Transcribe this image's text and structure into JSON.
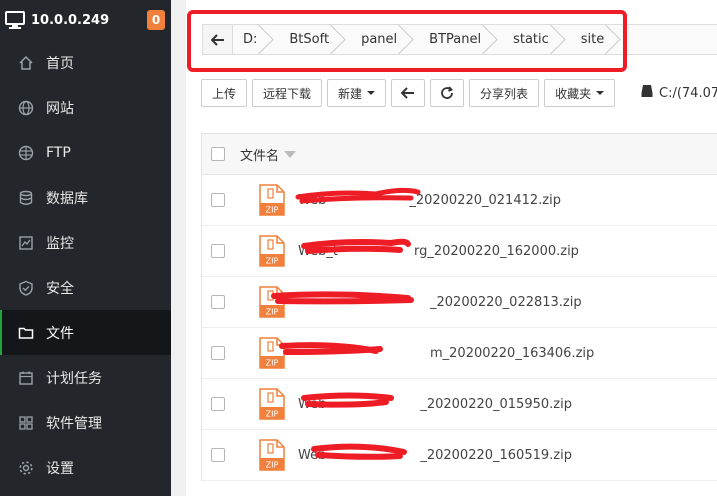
{
  "sidebar": {
    "server_ip": "10.0.0.249",
    "badge_count": "0",
    "items": [
      {
        "label": "首页",
        "icon": "home-icon"
      },
      {
        "label": "网站",
        "icon": "globe-icon"
      },
      {
        "label": "FTP",
        "icon": "ftp-globe-icon"
      },
      {
        "label": "数据库",
        "icon": "database-icon"
      },
      {
        "label": "监控",
        "icon": "monitor-icon"
      },
      {
        "label": "安全",
        "icon": "shield-icon"
      },
      {
        "label": "文件",
        "icon": "folder-icon",
        "active": true
      },
      {
        "label": "计划任务",
        "icon": "calendar-icon"
      },
      {
        "label": "软件管理",
        "icon": "apps-icon"
      },
      {
        "label": "设置",
        "icon": "gear-icon"
      }
    ]
  },
  "breadcrumb": [
    "D:",
    "BtSoft",
    "panel",
    "BTPanel",
    "static",
    "site"
  ],
  "toolbar": {
    "upload": "上传",
    "remote_download": "远程下载",
    "new": "新建",
    "share_list": "分享列表",
    "favorites": "收藏夹",
    "disk": "C:/(74.07"
  },
  "table": {
    "header_name": "文件名",
    "files": [
      {
        "prefix": "Web",
        "suffix": "_20200220_021412.zip"
      },
      {
        "prefix": "Web_t",
        "suffix": "rg_20200220_162000.zip"
      },
      {
        "prefix": "",
        "suffix": "_20200220_022813.zip"
      },
      {
        "prefix": "",
        "suffix": "m_20200220_163406.zip"
      },
      {
        "prefix": "Web",
        "suffix": "_20200220_015950.zip"
      },
      {
        "prefix": "Web",
        "suffix": "_20200220_160519.zip"
      }
    ]
  },
  "colors": {
    "sidebar_bg": "#23272c",
    "badge": "#f0803c",
    "highlight_box": "#ee1c25",
    "redaction": "#ee1c25",
    "zip_icon": "#f0803c"
  }
}
